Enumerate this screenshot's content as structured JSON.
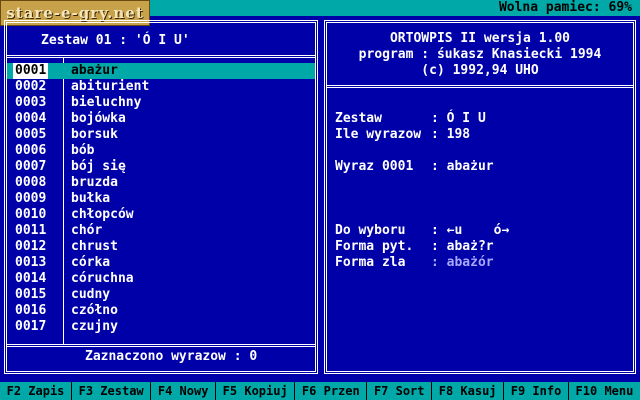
{
  "topbar": {
    "watermark": "stare-e-gry.net",
    "memory_label": "Wolna pamiec: 69%"
  },
  "list": {
    "title": "Zestaw 01 : 'Ó I U'",
    "selected_index": 0,
    "items": [
      {
        "num": "0001",
        "word": "abażur"
      },
      {
        "num": "0002",
        "word": "abiturient"
      },
      {
        "num": "0003",
        "word": "bieluchny"
      },
      {
        "num": "0004",
        "word": "bojówka"
      },
      {
        "num": "0005",
        "word": "borsuk"
      },
      {
        "num": "0006",
        "word": "bób"
      },
      {
        "num": "0007",
        "word": "bój się"
      },
      {
        "num": "0008",
        "word": "bruzda"
      },
      {
        "num": "0009",
        "word": "bułka"
      },
      {
        "num": "0010",
        "word": "chłopców"
      },
      {
        "num": "0011",
        "word": "chór"
      },
      {
        "num": "0012",
        "word": "chrust"
      },
      {
        "num": "0013",
        "word": "córka"
      },
      {
        "num": "0014",
        "word": "córuchna"
      },
      {
        "num": "0015",
        "word": "cudny"
      },
      {
        "num": "0016",
        "word": "czółno"
      },
      {
        "num": "0017",
        "word": "czujny"
      }
    ],
    "status": "Zaznaczono wyrazow : 0"
  },
  "info": {
    "head": [
      "ORTOWPIS II wersja 1.00",
      "program : śukasz Knasiecki 1994",
      "(c) 1992,94 UHO"
    ],
    "zestaw_label": "Zestaw",
    "zestaw_value": ": Ó I U",
    "ile_label": "Ile wyrazow",
    "ile_value": ": 198",
    "wyraz_label": "Wyraz 0001",
    "wyraz_value": ": abażur",
    "dowyboru_label": "Do wyboru",
    "dowyboru_value": ": ←u    ó→",
    "formapyt_label": "Forma pyt.",
    "formapyt_value": ": abaż?r",
    "formazla_label": "Forma zla",
    "formazla_value": ": abażór"
  },
  "fkeys": [
    "F2 Zapis",
    "F3 Zestaw",
    "F4 Nowy",
    "F5 Kopiuj",
    "F6 Przen",
    "F7 Sort",
    "F8 Kasuj",
    "F9 Info",
    "F10 Menu"
  ],
  "colors": {
    "background": "#0000a8",
    "bar": "#00a8a8",
    "text": "#ffffff",
    "muted": "#a8a8ff"
  }
}
